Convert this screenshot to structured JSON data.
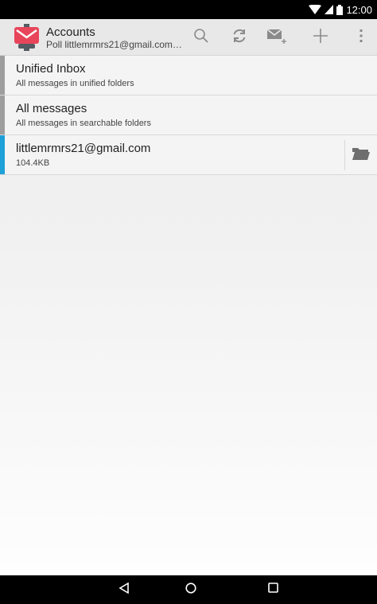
{
  "status_bar": {
    "time": "12:00",
    "icons": [
      "wifi-icon",
      "cell-signal-icon",
      "battery-icon"
    ]
  },
  "app_bar": {
    "title": "Accounts",
    "subtitle": "Poll littlemrmrs21@gmail.com:In...",
    "actions": [
      "search-icon",
      "refresh-icon",
      "compose-icon",
      "add-icon",
      "overflow-menu-icon"
    ]
  },
  "list": {
    "items": [
      {
        "title": "Unified Inbox",
        "subtitle": "All messages in unified folders",
        "stripe_color": "#9e9e9e"
      },
      {
        "title": "All messages",
        "subtitle": "All messages in searchable folders",
        "stripe_color": "#9e9e9e"
      },
      {
        "title": "littlemrmrs21@gmail.com",
        "subtitle": "104.4KB",
        "stripe_color": "#1ea0d8",
        "action_icon": "folder-icon"
      }
    ]
  },
  "nav_bar": {
    "buttons": [
      "back-icon",
      "home-icon",
      "recents-icon"
    ]
  },
  "colors": {
    "app_icon_red": "#e8455a",
    "app_icon_dark": "#555b63",
    "account_stripe": "#1ea0d8",
    "icon_gray": "#8a8a8a"
  }
}
